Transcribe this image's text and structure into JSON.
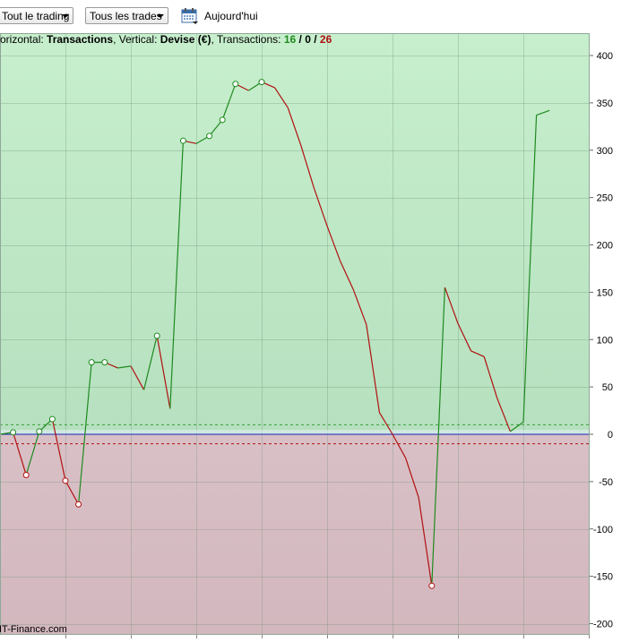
{
  "toolbar": {
    "trading_select": "Tout le trading",
    "trades_select": "Tous les trades",
    "today_label": "Aujourd'hui",
    "calendar_icon": "calendar-icon"
  },
  "info": {
    "horizontal_label": "orizontal: ",
    "horizontal_value": "Transactions",
    "vertical_label": ", Vertical: ",
    "vertical_value": "Devise (€)",
    "transactions_label": ", Transactions: ",
    "count_green": "16",
    "sep1": " / ",
    "count_zero": "0",
    "sep2": " / ",
    "count_red": "26"
  },
  "watermark": "IT-Finance.com",
  "colors": {
    "positive_area": "#bfeac6",
    "negative_area": "#d6bcc2",
    "rising_line": "#1f8a1f",
    "falling_line": "#b01010",
    "zero_line": "#2a2acc",
    "threshold_line": "#3aa03a"
  },
  "chart_data": {
    "type": "line",
    "xlabel": "Transactions",
    "ylabel": "Devise (€)",
    "ylim": [
      -210,
      425
    ],
    "y_ticks": [
      400,
      350,
      300,
      250,
      200,
      150,
      100,
      50,
      0,
      -50,
      -100,
      -150,
      -200
    ],
    "y_tick_labels": [
      "400",
      "350",
      "300",
      "250",
      "200",
      "150",
      "100",
      "50",
      "0",
      "-50",
      "-100",
      "-150",
      "-200"
    ],
    "zero_band": [
      -10,
      10
    ],
    "grid": true,
    "series": [
      {
        "x": [
          0,
          1,
          2,
          3,
          4,
          5,
          6,
          7,
          8,
          9,
          10,
          11,
          12,
          13,
          14,
          15,
          16,
          17,
          18,
          19,
          20,
          21,
          22,
          23,
          24,
          25,
          26,
          27,
          28,
          29,
          30,
          31,
          32,
          33,
          34,
          35,
          36,
          37,
          38,
          39,
          40,
          41,
          42
        ],
        "values": [
          0,
          2,
          -43,
          3,
          16,
          -49,
          -74,
          76,
          76,
          70,
          72,
          47,
          104,
          27,
          310,
          307,
          315,
          332,
          370,
          363,
          372,
          366,
          345,
          305,
          260,
          220,
          183,
          153,
          116,
          23,
          0,
          -25,
          -67,
          -160,
          155,
          117,
          88,
          82,
          38,
          3,
          13,
          337,
          342
        ],
        "markers": [
          1,
          2,
          3,
          4,
          5,
          6,
          7,
          8,
          12,
          14,
          16,
          17,
          18,
          20,
          33
        ]
      }
    ]
  }
}
